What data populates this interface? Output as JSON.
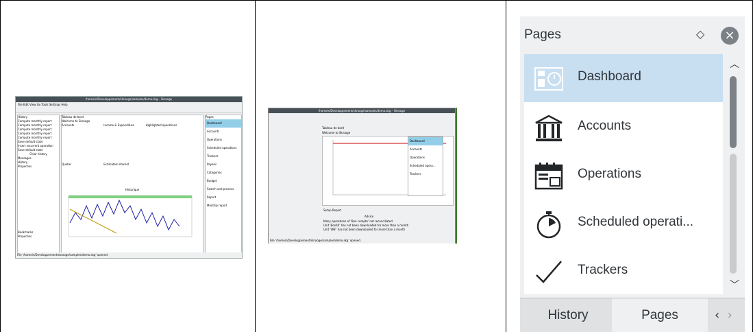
{
  "panel1": {
    "window_title": "/home/s/Developpement/skrooge/samples/demo.skg – Skrooge",
    "menu": [
      "File",
      "Edit",
      "View",
      "Go",
      "Tools",
      "Settings",
      "Help"
    ],
    "history_title": "History",
    "history_items": [
      "Compute monthly report",
      "Compute monthly report",
      "Compute monthly report",
      "Compute monthly report",
      "Compute monthly report",
      "Save default state",
      "Insert recurrent operation",
      "Save default state"
    ],
    "clear_history": "Clear history",
    "left_tabs": [
      "Messages",
      "History"
    ],
    "properties_title": "Properties",
    "bottom_tabs": [
      "Bookmarks",
      "Properties"
    ],
    "center_tab": "Tableau de bord",
    "welcome": "Welcome to Skrooge",
    "accounts_title": "Accounts",
    "income_title": "Income & Expenditure",
    "highlighted_title": "Highlighted operations",
    "quotes_title": "Quotes",
    "estimated_interest_title": "Estimated interest",
    "historique_title": "Historique",
    "pages_title": "Pages",
    "pages_items": [
      "Dashboard",
      "Accounts",
      "Operations",
      "Scheduled operations",
      "Trackers",
      "Payees",
      "Categories",
      "Budget",
      "Search and process",
      "Report",
      "Monthly report"
    ],
    "status": "File '/home/s/Developpement/skrooge/samples/demo.skg' opened."
  },
  "panel2": {
    "window_title": "/home/s/Developpement/skrooge/samples/demo.skg – Skrooge",
    "center_tab": "Tableau de bord",
    "welcome": "Welcome to Skrooge",
    "setup_report": "Setup Report",
    "advice_title": "Advice",
    "advice_items": [
      "Many operations of 'Bon compte' not reconciliated",
      "Unit 'Bon40' has not been downloaded for more than a month",
      "Unit 'SNF' has not been downloaded for more than a month"
    ],
    "pages_items": [
      "Dashboard",
      "Accounts",
      "Operations",
      "Scheduled opera...",
      "Trackers"
    ],
    "status": "File '/home/s/Developpement/skrooge/samples/demo.skg' opened."
  },
  "zoom": {
    "title": "Pages",
    "items": [
      {
        "label": "Dashboard",
        "icon": "dashboard-icon",
        "selected": true
      },
      {
        "label": "Accounts",
        "icon": "bank-icon",
        "selected": false
      },
      {
        "label": "Operations",
        "icon": "calendar-icon",
        "selected": false
      },
      {
        "label": "Scheduled operati...",
        "icon": "stopwatch-icon",
        "selected": false
      },
      {
        "label": "Trackers",
        "icon": "checkmark-icon",
        "selected": false
      }
    ],
    "tabs": [
      "History",
      "Pages"
    ]
  },
  "colors": {
    "selection": "#c8dff2",
    "accent": "#3daee9",
    "scrollbar": "#7b8186"
  }
}
